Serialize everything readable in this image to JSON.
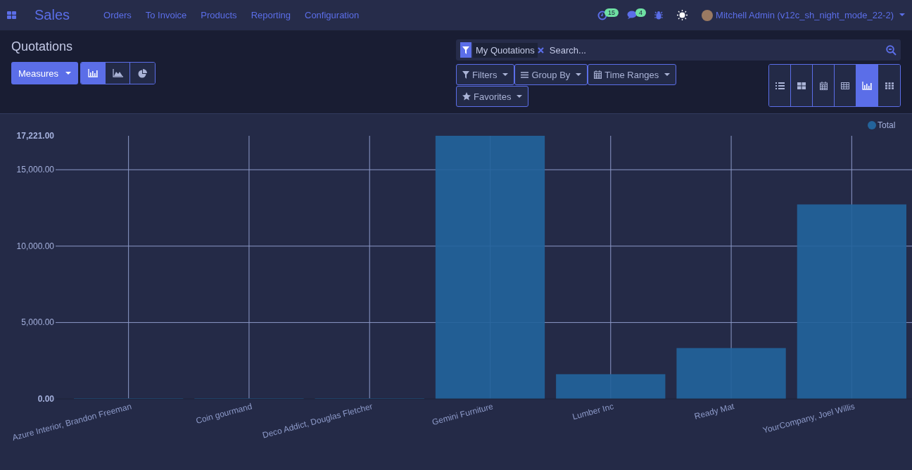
{
  "navbar": {
    "app_name": "Sales",
    "menu": [
      "Orders",
      "To Invoice",
      "Products",
      "Reporting",
      "Configuration"
    ],
    "activity_count": "15",
    "message_count": "4",
    "user": "Mitchell Admin (v12c_sh_night_mode_22-2)"
  },
  "control_panel": {
    "title": "Quotations",
    "measures_button": "Measures",
    "chart_types": [
      {
        "kind": "bar",
        "selected": true
      },
      {
        "kind": "line",
        "selected": false
      },
      {
        "kind": "pie",
        "selected": false
      }
    ],
    "search": {
      "facet": "My Quotations",
      "placeholder": "Search..."
    },
    "search_buttons": [
      {
        "kind": "filter",
        "label": "Filters"
      },
      {
        "kind": "groupby",
        "label": "Group By"
      },
      {
        "kind": "time",
        "label": "Time Ranges"
      },
      {
        "kind": "favorite",
        "label": "Favorites"
      }
    ],
    "views": [
      {
        "kind": "list",
        "selected": false
      },
      {
        "kind": "kanban",
        "selected": false
      },
      {
        "kind": "calendar",
        "selected": false
      },
      {
        "kind": "pivot",
        "selected": false
      },
      {
        "kind": "graph",
        "selected": true
      },
      {
        "kind": "cohort",
        "selected": false
      }
    ]
  },
  "chart_data": {
    "type": "bar",
    "categories": [
      "Azure Interior, Brandon Freeman",
      "Coin gourmand",
      "Deco Addict, Douglas Fletcher",
      "Gemini Furniture",
      "Lumber Inc",
      "Ready Mat",
      "YourCompany, Joel Willis"
    ],
    "series": [
      {
        "name": "Total",
        "color": "#23639b",
        "values": [
          0,
          0,
          0,
          17221,
          1620,
          3330,
          12730
        ]
      }
    ],
    "ylim": [
      0,
      17221
    ],
    "grid": true,
    "yticks": [
      {
        "value": 0,
        "label": "0.00"
      },
      {
        "value": 5000,
        "label": "5,000.00"
      },
      {
        "value": 10000,
        "label": "10,000.00"
      },
      {
        "value": 15000,
        "label": "15,000.00"
      },
      {
        "value": 17221,
        "label": "17,221.00"
      }
    ]
  }
}
